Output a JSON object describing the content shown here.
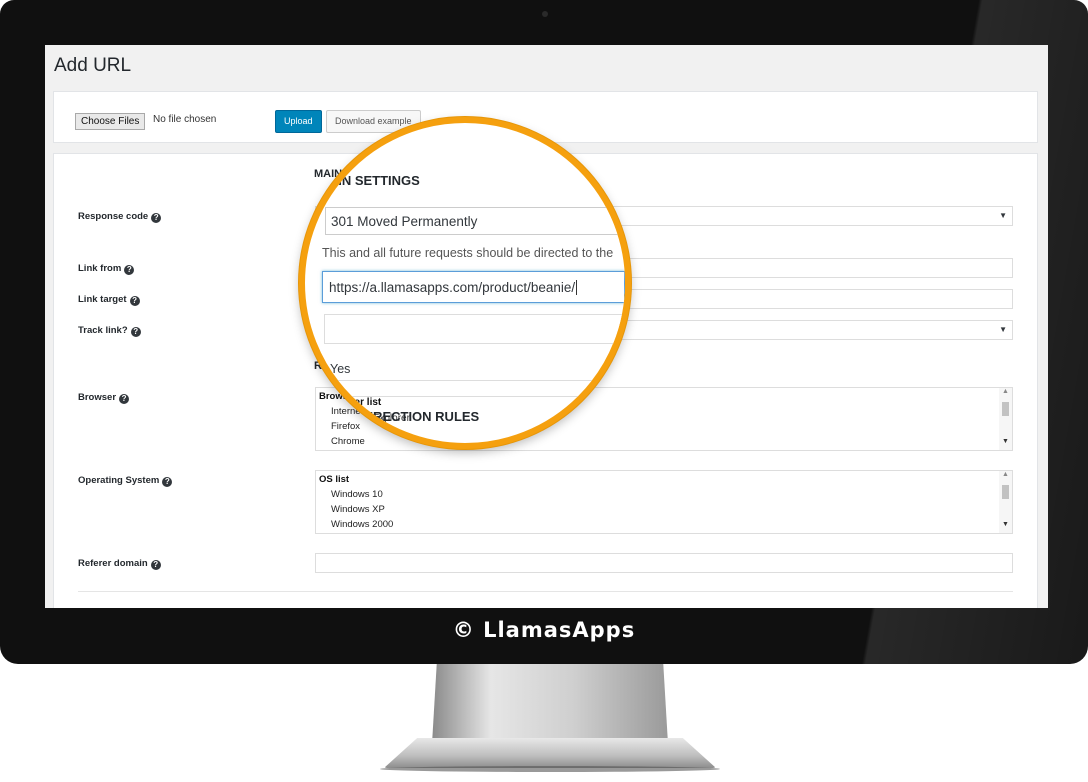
{
  "page": {
    "title": "Add URL"
  },
  "upload": {
    "choose_label": "Choose Files",
    "file_status": "No file chosen",
    "upload_label": "Upload",
    "download_label": "Download example"
  },
  "form": {
    "main_heading": "MAIN SETTINGS",
    "redirection_heading": "REDIRECTION RULES",
    "response_code": {
      "label": "Response code",
      "value": "301 Moved Permanently",
      "description": "This and all future requests should be directed to the"
    },
    "link_from": {
      "label": "Link from",
      "value": "https://a.llamasapps.com/product/beanie/"
    },
    "link_target": {
      "label": "Link target",
      "value": ""
    },
    "track_link": {
      "label": "Track link?",
      "value": "Yes"
    },
    "browser": {
      "label": "Browser",
      "list_header": "Browser list",
      "items": [
        "Internet Explorer",
        "Firefox",
        "Chrome"
      ]
    },
    "os": {
      "label": "Operating System",
      "list_header": "OS list",
      "items": [
        "Windows 10",
        "Windows XP",
        "Windows 2000"
      ]
    },
    "referer": {
      "label": "Referer domain",
      "value": ""
    }
  },
  "icons": {
    "help": "question-circle-icon",
    "dropdown": "caret-down-icon"
  },
  "brand": {
    "text": "© LlamasApps"
  },
  "colors": {
    "accent": "#f5a00f",
    "primary_button": "#0085ba",
    "bezel": "#101010"
  }
}
